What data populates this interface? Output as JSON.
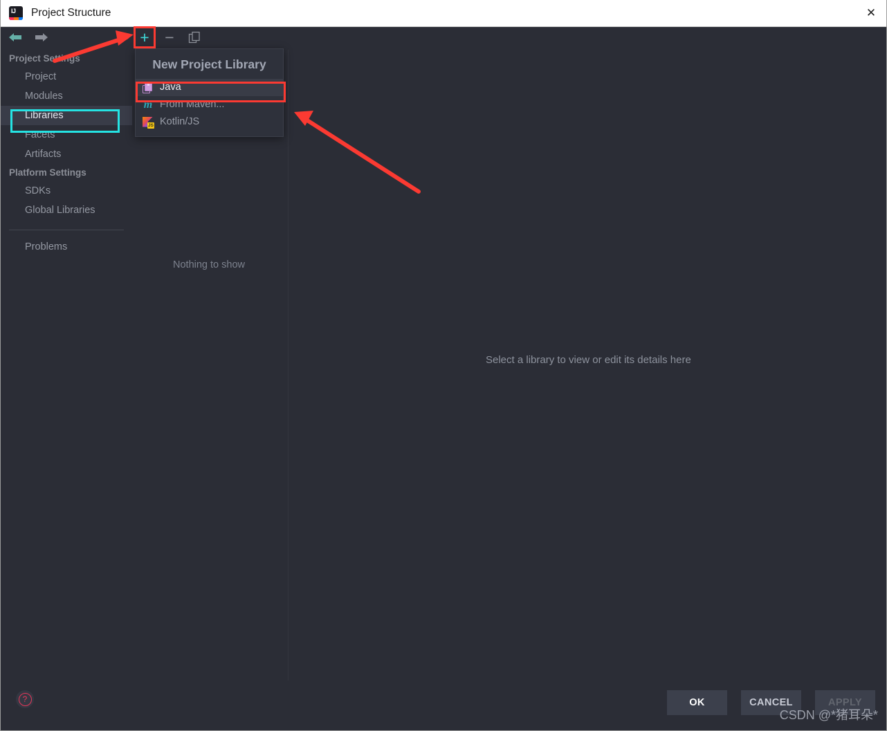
{
  "window": {
    "title": "Project Structure",
    "app_icon": "intellij-idea-icon",
    "close_label": "✕"
  },
  "toolbar": {
    "back_icon": "back-arrow-icon",
    "forward_icon": "forward-arrow-icon",
    "add_label": "+",
    "remove_label": "−",
    "copy_icon": "copy-icon"
  },
  "sidebar": {
    "groups": [
      {
        "title": "Project Settings",
        "items": [
          {
            "label": "Project",
            "selected": false
          },
          {
            "label": "Modules",
            "selected": false
          },
          {
            "label": "Libraries",
            "selected": true
          },
          {
            "label": "Facets",
            "selected": false
          },
          {
            "label": "Artifacts",
            "selected": false
          }
        ]
      },
      {
        "title": "Platform Settings",
        "items": [
          {
            "label": "SDKs",
            "selected": false
          },
          {
            "label": "Global Libraries",
            "selected": false
          }
        ]
      }
    ],
    "problems_label": "Problems"
  },
  "list_pane": {
    "empty_text": "Nothing to show"
  },
  "detail_pane": {
    "hint_text": "Select a library to view or edit its details here"
  },
  "popup": {
    "title": "New Project Library",
    "items": [
      {
        "label": "Java",
        "icon": "java-library-icon",
        "highlighted": true
      },
      {
        "label": "From Maven...",
        "icon": "maven-icon",
        "highlighted": false
      },
      {
        "label": "Kotlin/JS",
        "icon": "kotlin-js-icon",
        "highlighted": false
      }
    ]
  },
  "bottom": {
    "help_label": "?",
    "ok_label": "OK",
    "cancel_label": "CANCEL",
    "apply_label": "APPLY"
  },
  "annotations": {
    "watermark": "CSDN @*猪耳朵*",
    "highlight_color_red": "#fb3a32",
    "highlight_color_cyan": "#25e3e3",
    "arrow_color": "#fb3a32"
  }
}
